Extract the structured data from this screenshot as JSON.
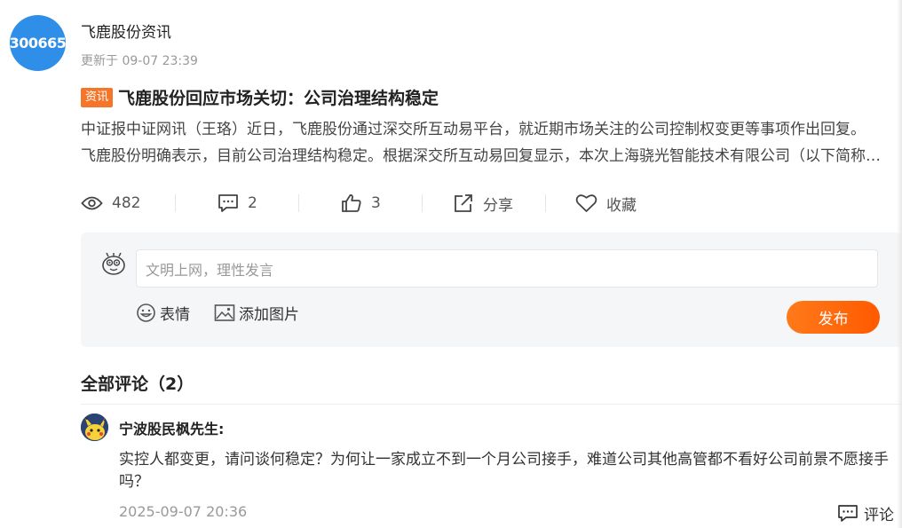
{
  "source": {
    "badge": "300665",
    "name": "飞鹿股份资讯",
    "updated": "更新于 09-07 23:39",
    "badge_color": "#2f8fe8"
  },
  "article": {
    "tag": "资讯",
    "title": "飞鹿股份回应市场关切：公司治理结构稳定",
    "summary_line1": "中证报中证网讯（王珞）近日，飞鹿股份通过深交所互动易平台，就近期市场关注的公司控制权变更等事项作出回复。",
    "summary_line2": "飞鹿股份明确表示，目前公司治理结构稳定。根据深交所互动易回复显示，本次上海骁光智能技术有限公司（以下简称…"
  },
  "actions": {
    "views": "482",
    "comments": "2",
    "likes": "3",
    "share": "分享",
    "favorite": "收藏"
  },
  "composer": {
    "placeholder": "文明上网，理性发言",
    "emoji": "表情",
    "add_image": "添加图片",
    "publish": "发布",
    "publish_color": "#ff6a0d"
  },
  "comments": {
    "heading": "全部评论（2）",
    "items": [
      {
        "user": "宁波股民枫先生:",
        "text": "实控人都变更，请问谈何稳定？为何让一家成立不到一个月公司接手，难道公司其他高管都不看好公司前景不愿接手吗？",
        "time": "2025-09-07 20:36",
        "reply": "评论"
      }
    ]
  }
}
